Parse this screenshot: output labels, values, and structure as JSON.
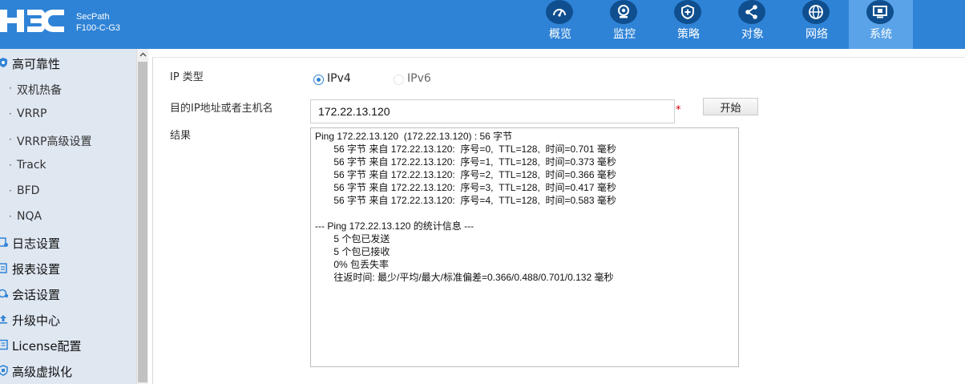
{
  "header": {
    "logo_text": "H3C",
    "product_name": "SecPath",
    "product_model": "F100-C-G3",
    "nav": [
      {
        "label": "概览",
        "icon": "gauge-icon",
        "active": false
      },
      {
        "label": "监控",
        "icon": "camera-icon",
        "active": false
      },
      {
        "label": "策略",
        "icon": "shield-plus-icon",
        "active": false
      },
      {
        "label": "对象",
        "icon": "share-icon",
        "active": false
      },
      {
        "label": "网络",
        "icon": "globe-icon",
        "active": false
      },
      {
        "label": "系统",
        "icon": "monitor-icon",
        "active": true
      }
    ]
  },
  "sidebar": {
    "groups_top": {
      "label": "高可靠性",
      "icon": "shield-icon"
    },
    "sub_items": [
      "双机热备",
      "VRRP",
      "VRRP高级设置",
      "Track",
      "BFD",
      "NQA"
    ],
    "groups": [
      {
        "label": "日志设置",
        "icon": "log-settings-icon"
      },
      {
        "label": "报表设置",
        "icon": "report-icon"
      },
      {
        "label": "会话设置",
        "icon": "session-icon"
      },
      {
        "label": "升级中心",
        "icon": "upgrade-icon"
      },
      {
        "label": "License配置",
        "icon": "license-icon"
      },
      {
        "label": "高级虚拟化",
        "icon": "virtualization-icon"
      }
    ]
  },
  "form": {
    "ip_type_label": "IP 类型",
    "ip_options": [
      {
        "label": "IPv4",
        "checked": true
      },
      {
        "label": "IPv6",
        "checked": false
      }
    ],
    "target_label": "目的IP地址或者主机名",
    "target_value": "172.22.13.120",
    "required_mark": "*",
    "start_label": "开始",
    "result_label": "结果",
    "result_lines": [
      "Ping 172.22.13.120  (172.22.13.120) : 56 字节",
      "       56 字节 来自 172.22.13.120:  序号=0,  TTL=128,  时间=0.701 毫秒",
      "       56 字节 来自 172.22.13.120:  序号=1,  TTL=128,  时间=0.373 毫秒",
      "       56 字节 来自 172.22.13.120:  序号=2,  TTL=128,  时间=0.366 毫秒",
      "       56 字节 来自 172.22.13.120:  序号=3,  TTL=128,  时间=0.417 毫秒",
      "       56 字节 来自 172.22.13.120:  序号=4,  TTL=128,  时间=0.583 毫秒",
      "",
      "--- Ping 172.22.13.120 的统计信息 ---",
      "       5 个包已发送",
      "       5 个包已接收",
      "       0% 包丢失率",
      "       往返时间: 最少/平均/最大/标准偏差=0.366/0.488/0.701/0.132 毫秒"
    ]
  },
  "colors": {
    "header_bg": "#2f83d6",
    "nav_active_bg": "#5aa3e8",
    "sidebar_bg": "#dfe7f1",
    "accent": "#2f83d6",
    "required": "#d40000"
  }
}
